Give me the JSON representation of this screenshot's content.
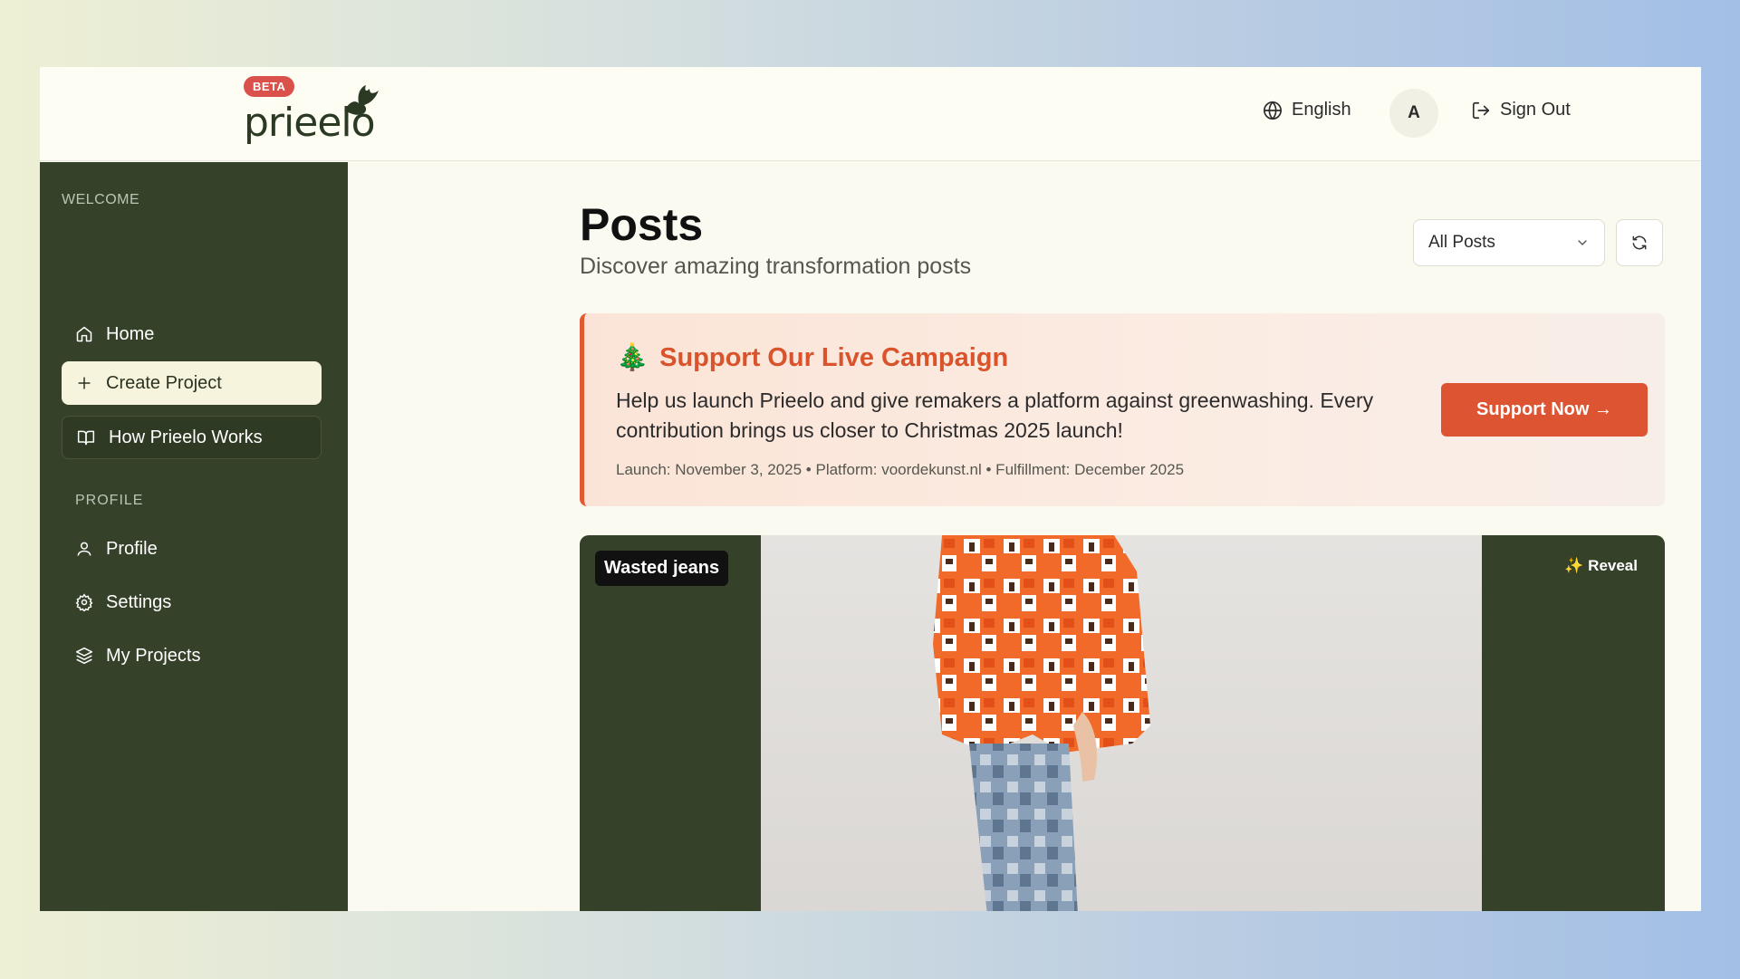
{
  "header": {
    "beta": "BETA",
    "logo": "prieelo",
    "language": "English",
    "avatar_initial": "A",
    "sign_out": "Sign Out"
  },
  "sidebar": {
    "welcome": "WELCOME",
    "items": [
      {
        "label": "Home",
        "icon": "home-icon"
      },
      {
        "label": "Create Project",
        "icon": "plus-icon"
      },
      {
        "label": "How Prieelo Works",
        "icon": "book-icon"
      }
    ],
    "profile_section": "PROFILE",
    "profile_items": [
      {
        "label": "Profile",
        "icon": "user-icon"
      },
      {
        "label": "Settings",
        "icon": "gear-icon"
      },
      {
        "label": "My Projects",
        "icon": "layers-icon"
      }
    ]
  },
  "main": {
    "title": "Posts",
    "subtitle": "Discover amazing transformation posts",
    "filter": "All Posts"
  },
  "campaign": {
    "emoji": "🎄",
    "title": "Support Our Live Campaign",
    "text": "Help us launch Prieelo and give remakers a platform against greenwashing. Every contribution brings us closer to Christmas 2025 launch!",
    "meta": "Launch: November 3, 2025 • Platform: voordekunst.nl • Fulfillment: December 2025",
    "button": "Support Now →"
  },
  "post": {
    "tag": "Wasted jeans",
    "reveal": "✨ Reveal"
  },
  "colors": {
    "sidebar": "#36412a",
    "accent": "#dc5431",
    "beta": "#d9514a"
  }
}
